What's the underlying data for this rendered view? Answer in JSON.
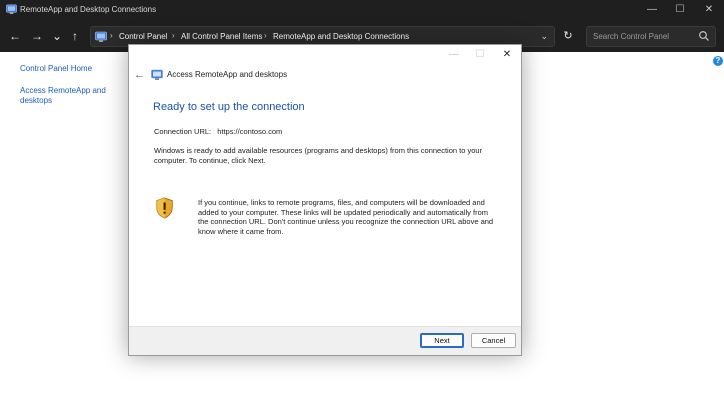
{
  "window": {
    "title": "RemoteApp and Desktop Connections",
    "controls": {
      "minimize": "—",
      "maximize": "☐",
      "close": "✕"
    }
  },
  "nav": {
    "back": "←",
    "forward": "→",
    "recent": "⌄",
    "up": "↑",
    "breadcrumbs": [
      "Control Panel",
      "All Control Panel Items",
      "RemoteApp and Desktop Connections"
    ],
    "separator": "›",
    "dropdown": "⌄",
    "refresh": "↻",
    "search_placeholder": "Search Control Panel"
  },
  "sidebar": {
    "items": [
      {
        "label": "Control Panel Home"
      },
      {
        "label": "Access RemoteApp and desktops"
      }
    ]
  },
  "help": "?",
  "dialog": {
    "back": "←",
    "title": "Access RemoteApp and desktops",
    "controls": {
      "minimize": "—",
      "maximize": "☐",
      "close": "✕"
    },
    "heading": "Ready to set up the connection",
    "url_label": "Connection URL:",
    "url_value": "https://contoso.com",
    "paragraph1": "Windows is ready to add available resources (programs and desktops) from this connection to your computer. To continue, click Next.",
    "warning": "If you continue, links to remote programs, files, and computers will be downloaded and added to your computer.  These links will be updated periodically and automatically from the connection URL. Don't continue unless you recognize the connection URL above and know where it came from.",
    "next_label": "Next",
    "cancel_label": "Cancel"
  },
  "colors": {
    "titlebar": "#1f1f1f",
    "link": "#1a5fb4",
    "heading": "#1c53a5",
    "shield": "#e8a92a"
  }
}
